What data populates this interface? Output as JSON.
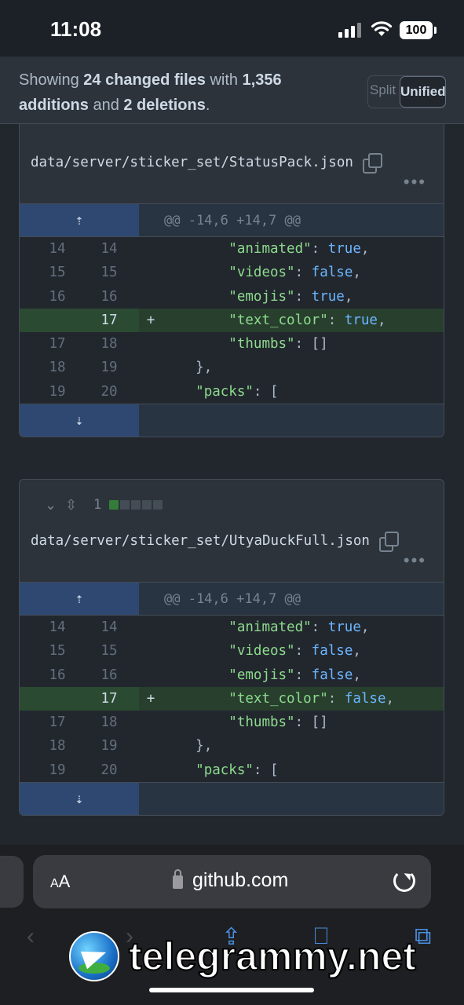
{
  "status": {
    "time": "11:08",
    "battery": "100"
  },
  "summary": {
    "prefix": "Showing ",
    "files": "24 changed files",
    "mid": " with ",
    "additions": "1,356 additions",
    "and": " and ",
    "deletions": "2 deletions",
    "end": ".",
    "split_label": "Split",
    "unified_label": "Unified"
  },
  "files": [
    {
      "path": "data/server/sticker_set/StatusPack.json",
      "hunk_header": "@@ -14,6 +14,7 @@",
      "lines": [
        {
          "old": "14",
          "new": "14",
          "sign": "",
          "key": "\"animated\"",
          "val": "true",
          "indent": "        ",
          "type": "ctx"
        },
        {
          "old": "15",
          "new": "15",
          "sign": "",
          "key": "\"videos\"",
          "val": "false",
          "indent": "        ",
          "type": "ctx"
        },
        {
          "old": "16",
          "new": "16",
          "sign": "",
          "key": "\"emojis\"",
          "val": "true",
          "indent": "        ",
          "type": "ctx"
        },
        {
          "old": "",
          "new": "17",
          "sign": "+",
          "key": "\"text_color\"",
          "val": "true",
          "indent": "        ",
          "type": "add"
        },
        {
          "old": "17",
          "new": "18",
          "sign": "",
          "key": "\"thumbs\"",
          "val": "[]",
          "indent": "        ",
          "type": "ctx"
        },
        {
          "old": "18",
          "new": "19",
          "sign": "",
          "key": "",
          "val": "},",
          "indent": "    ",
          "type": "ctx"
        },
        {
          "old": "19",
          "new": "20",
          "sign": "",
          "key": "\"packs\"",
          "val": "[",
          "indent": "    ",
          "type": "ctx"
        }
      ]
    },
    {
      "path": "data/server/sticker_set/UtyaDuckFull.json",
      "count": "1",
      "hunk_header": "@@ -14,6 +14,7 @@",
      "lines": [
        {
          "old": "14",
          "new": "14",
          "sign": "",
          "key": "\"animated\"",
          "val": "true",
          "indent": "        ",
          "type": "ctx"
        },
        {
          "old": "15",
          "new": "15",
          "sign": "",
          "key": "\"videos\"",
          "val": "false",
          "indent": "        ",
          "type": "ctx"
        },
        {
          "old": "16",
          "new": "16",
          "sign": "",
          "key": "\"emojis\"",
          "val": "false",
          "indent": "        ",
          "type": "ctx"
        },
        {
          "old": "",
          "new": "17",
          "sign": "+",
          "key": "\"text_color\"",
          "val": "false",
          "indent": "        ",
          "type": "add"
        },
        {
          "old": "17",
          "new": "18",
          "sign": "",
          "key": "\"thumbs\"",
          "val": "[]",
          "indent": "        ",
          "type": "ctx"
        },
        {
          "old": "18",
          "new": "19",
          "sign": "",
          "key": "",
          "val": "},",
          "indent": "    ",
          "type": "ctx"
        },
        {
          "old": "19",
          "new": "20",
          "sign": "",
          "key": "\"packs\"",
          "val": "[",
          "indent": "    ",
          "type": "ctx"
        }
      ]
    }
  ],
  "browser": {
    "aa_small": "A",
    "aa_big": "A",
    "host": "github.com"
  },
  "watermark": "telegrammy.net"
}
